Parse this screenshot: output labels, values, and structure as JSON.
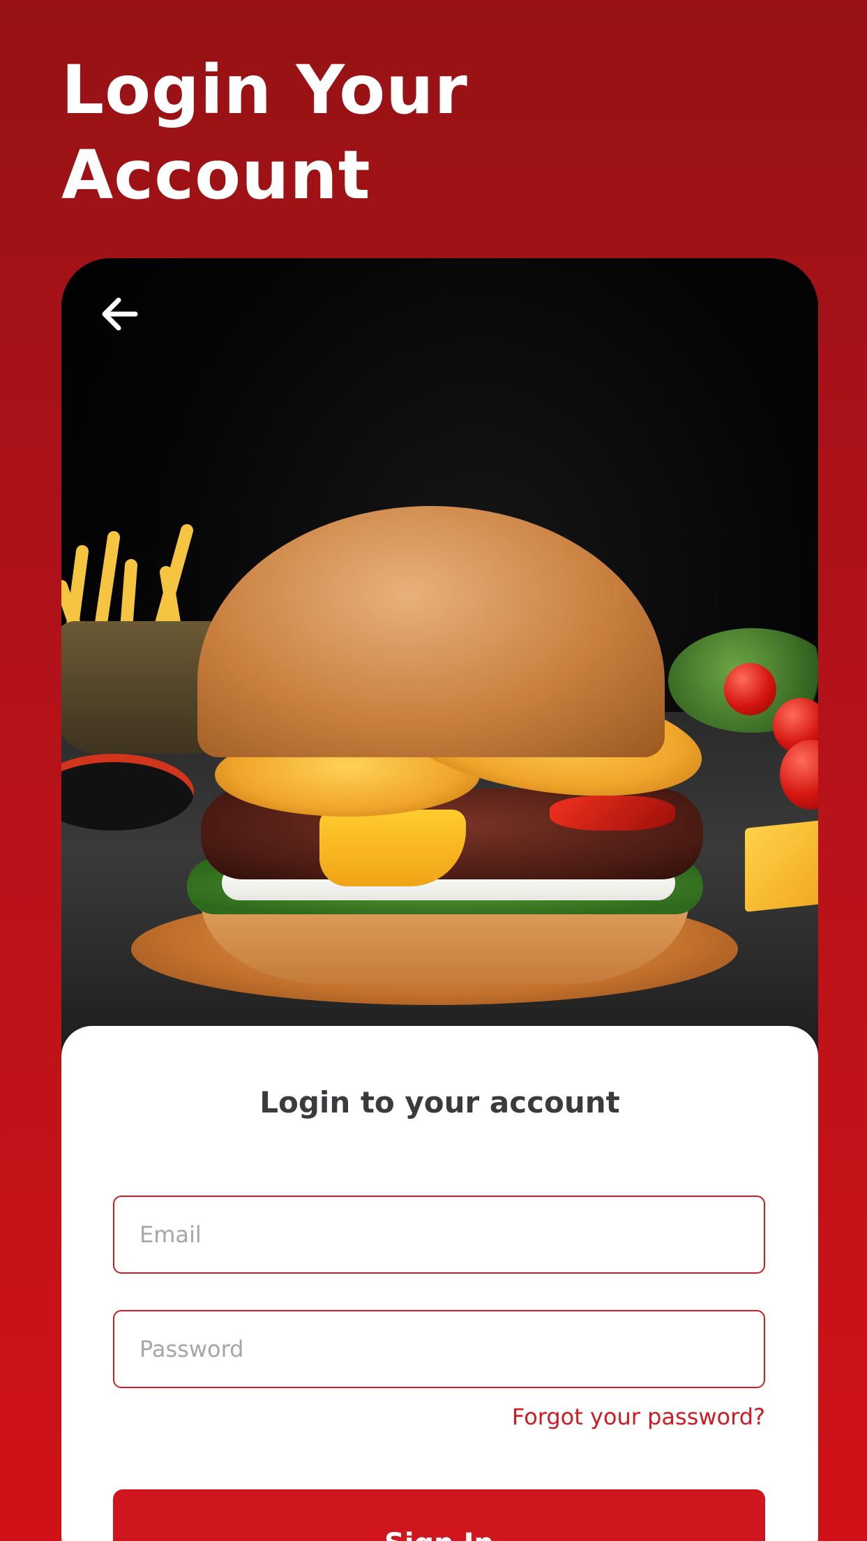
{
  "header": {
    "title_line1": "Login  Your",
    "title_line2": "Account"
  },
  "hero": {
    "back_icon": "arrow-left-icon",
    "image_subject": "burger-photo"
  },
  "login_form": {
    "title": "Login to your account",
    "email_placeholder": "Email",
    "password_placeholder": "Password",
    "forgot_password_label": "Forgot your password?",
    "sign_in_label": "Sign In"
  },
  "colors": {
    "accent": "#cf151d",
    "background_top": "#961214",
    "background_bottom": "#d01218",
    "panel_title": "#3b3b3f"
  }
}
